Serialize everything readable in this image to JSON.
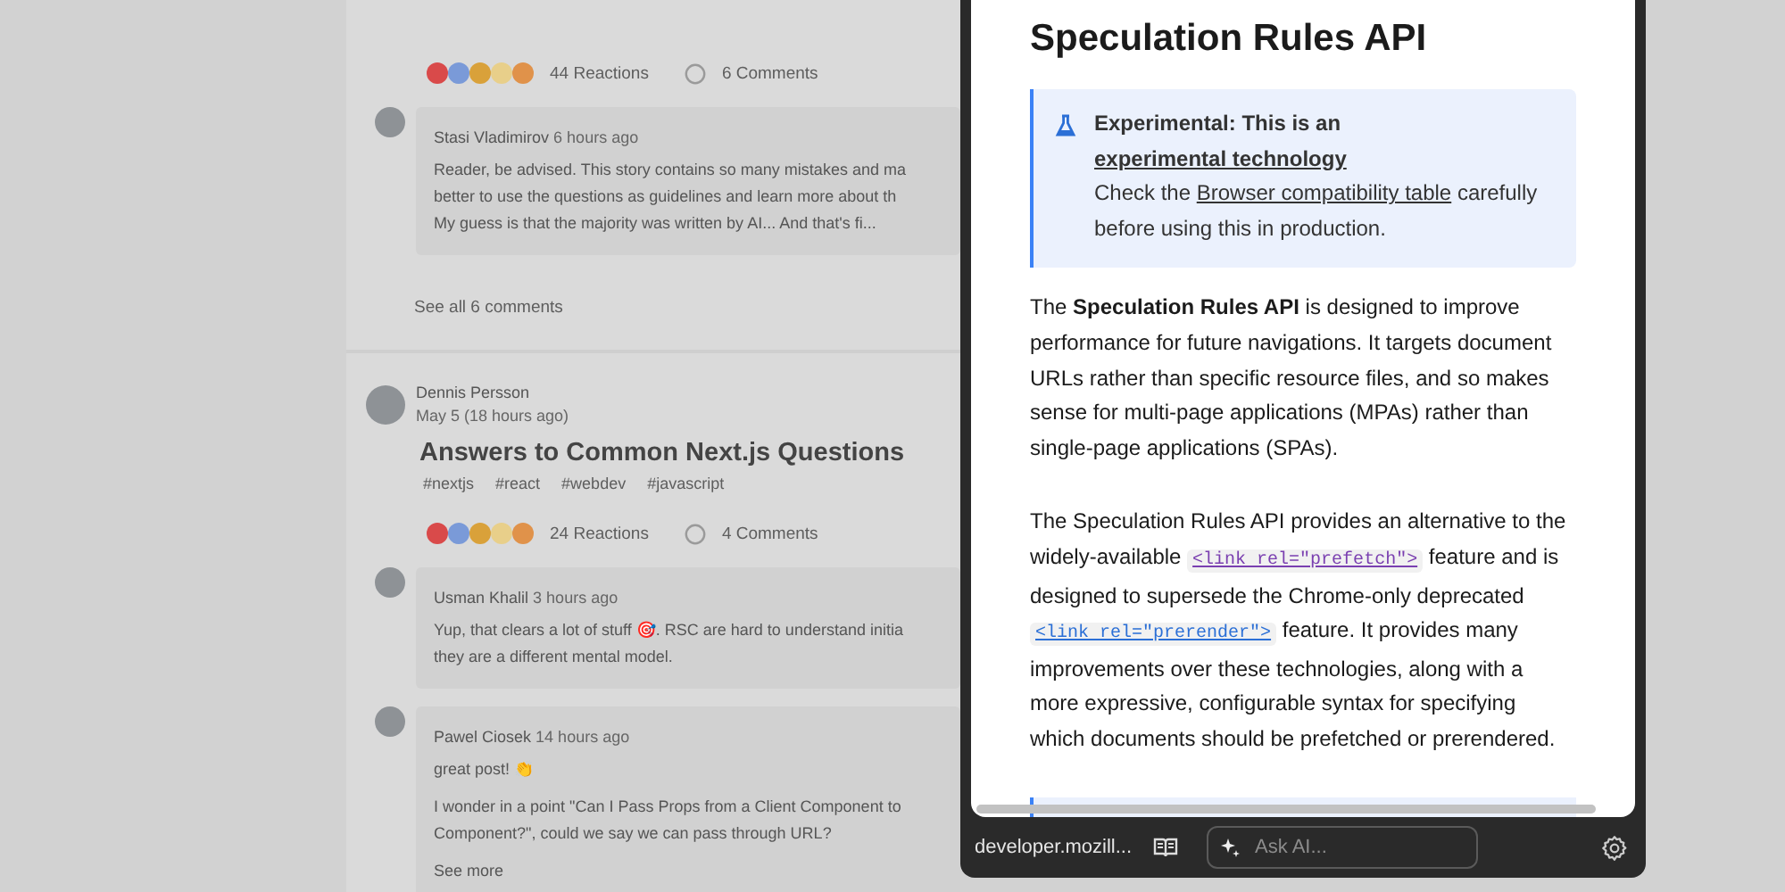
{
  "feed": {
    "posts": [
      {
        "reactions": "44 Reactions",
        "comments_count": "6 Comments",
        "comments": [
          {
            "author": "Stasi Vladimirov",
            "time": "6 hours ago",
            "lines": [
              "Reader, be advised. This story contains so many mistakes and ma",
              "better to use the questions as guidelines and learn more about th",
              "My guess is that the majority was written by AI... And that's fi..."
            ]
          }
        ],
        "see_all": "See all 6 comments"
      },
      {
        "author": "Dennis Persson",
        "date": "May 5 (18 hours ago)",
        "title": "Answers to Common Next.js Questions",
        "tags": [
          "#nextjs",
          "#react",
          "#webdev",
          "#javascript"
        ],
        "reactions": "24 Reactions",
        "comments_count": "4 Comments",
        "comments": [
          {
            "author": "Usman Khalil",
            "time": "3 hours ago",
            "lines": [
              "Yup, that clears a lot of stuff 🎯. RSC are hard to understand initia",
              "they are a different mental model."
            ]
          },
          {
            "author": "Pawel Ciosek",
            "time": "14 hours ago",
            "lines": [
              "great post! 👏",
              "I wonder in a point \"Can I Pass Props from a Client Component to",
              "Component?\", could we say we can pass through URL?"
            ],
            "more": "See more"
          }
        ]
      }
    ]
  },
  "panel": {
    "title": "Speculation Rules API",
    "callout": {
      "title": [
        {
          "text": "Experimental: This is an "
        },
        {
          "kind": "link",
          "text": "experimental technology"
        }
      ],
      "body": [
        {
          "text": "Check the "
        },
        {
          "kind": "link",
          "text": "Browser compatibility table"
        },
        {
          "text": " carefully before using this in production."
        }
      ]
    },
    "paragraphs": [
      [
        {
          "text": "The **Speculation Rules API** is designed to improve performance for future navigations. It targets document URLs rather than specific resource files, and so makes sense for multi-page applications (MPAs) rather than single-page applications (SPAs)."
        }
      ],
      [
        {
          "text": "The Speculation Rules API provides an alternative to the widely-available "
        },
        {
          "kind": "code",
          "text": "<link rel=\"prefetch\">",
          "visited": true
        },
        {
          "text": " feature and is designed to supersede the Chrome-only deprecated "
        },
        {
          "kind": "code",
          "text": "<link rel=\"prerender\">",
          "visited": false
        },
        {
          "text": " feature. It provides many improvements over these technologies, along with a more expressive, configurable syntax for specifying which documents should be prefetched or prerendered."
        }
      ]
    ]
  },
  "bottom_bar": {
    "site": "developer.mozill...",
    "ask": {
      "placeholder": "Ask AI..."
    }
  }
}
